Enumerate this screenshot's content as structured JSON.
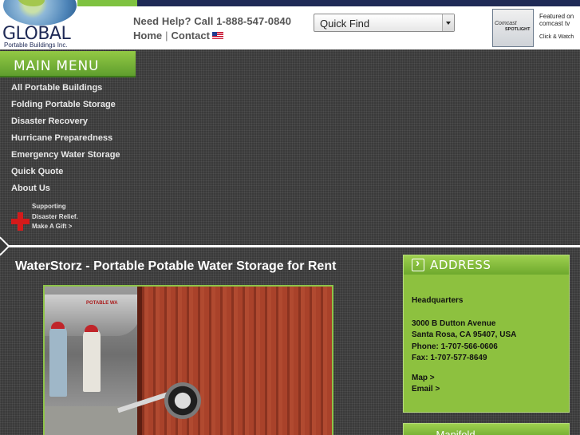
{
  "header": {
    "logo_word": "GLOBAL",
    "logo_sub": "Portable Buildings Inc.",
    "help_text": "Need Help?  Call 1-888-547-0840",
    "links": {
      "home": "Home",
      "separator": "|",
      "contact": "Contact"
    },
    "quick_find": "Quick Find",
    "comcast": {
      "brand": "Comcast",
      "badge": "SPOTLIGHT"
    },
    "featured_line1": "Featured on",
    "featured_line2": "comcast tv",
    "click_watch": "Click & Watch"
  },
  "menu": {
    "title": "MAIN MENU",
    "items": [
      "All Portable Buildings",
      "Folding Portable Storage",
      "Disaster Recovery",
      "Hurricane Preparedness",
      "Emergency Water Storage",
      "Quick Quote",
      "About Us"
    ],
    "relief": [
      "Supporting",
      "Disaster Relief.",
      "Make A Gift >"
    ]
  },
  "content": {
    "title": "WaterStorz - Portable Potable Water Storage for Rent",
    "photo_tank_label": "POTABLE WA"
  },
  "address": {
    "title": "ADDRESS",
    "heading": "Headquarters",
    "lines": [
      "3000 B Dutton Avenue",
      "Santa Rosa, CA 95407, USA",
      "Phone: 1-707-566-0606",
      "Fax: 1-707-577-8649"
    ],
    "map_link": "Map >",
    "email_link": "Email >"
  },
  "box2_title": "........ Manifold"
}
